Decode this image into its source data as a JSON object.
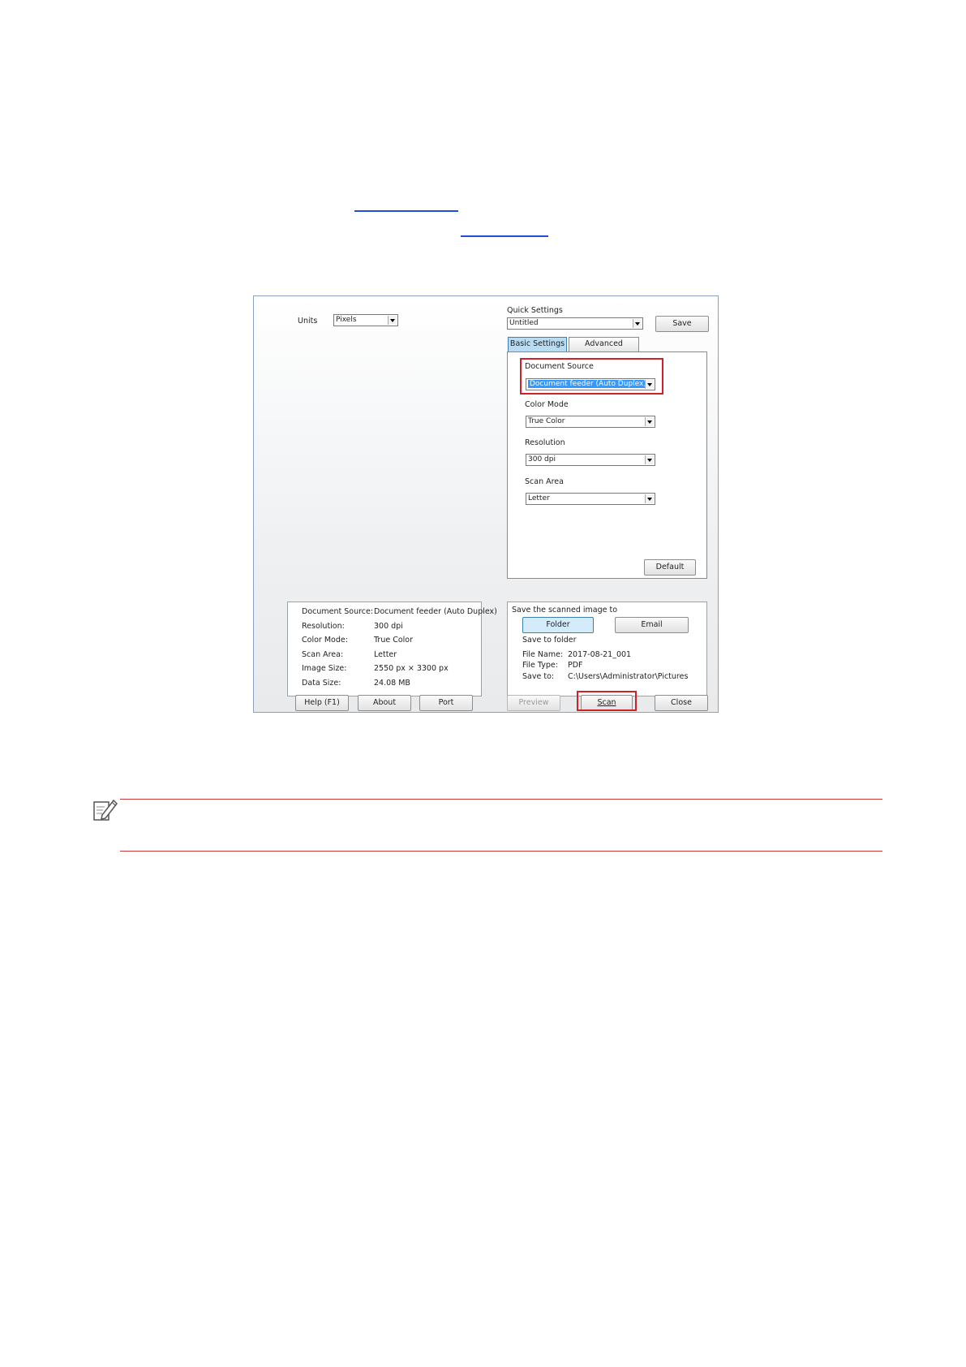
{
  "dialog": {
    "units_label": "Units",
    "units_value": "Pixels",
    "quick_settings_label": "Quick Settings",
    "quick_settings_value": "Untitled",
    "save_button": "Save",
    "tabs": [
      "Basic Settings",
      "Advanced Settings"
    ],
    "basic": {
      "document_source_label": "Document Source",
      "document_source_value": "Document feeder (Auto Duplex)",
      "color_mode_label": "Color Mode",
      "color_mode_value": "True Color",
      "resolution_label": "Resolution",
      "resolution_value": "300 dpi",
      "scan_area_label": "Scan Area",
      "scan_area_value": "Letter",
      "default_button": "Default"
    },
    "info": [
      {
        "k": "Document Source:",
        "v": "Document feeder (Auto Duplex)"
      },
      {
        "k": "Resolution:",
        "v": "300 dpi"
      },
      {
        "k": "Color Mode:",
        "v": "True Color"
      },
      {
        "k": "Scan Area:",
        "v": "Letter"
      },
      {
        "k": "Image Size:",
        "v": "2550 px × 3300 px"
      },
      {
        "k": "Data Size:",
        "v": "24.08 MB"
      }
    ],
    "save_panel": {
      "title": "Save the scanned image to",
      "folder_button": "Folder",
      "email_button": "Email",
      "save_to_folder": "Save to folder",
      "file_name_label": "File Name:",
      "file_name_value": "2017-08-21_001",
      "file_type_label": "File Type:",
      "file_type_value": "PDF",
      "save_to_label": "Save to:",
      "save_to_value": "C:\\Users\\Administrator\\Pictures"
    },
    "bottom_buttons": {
      "help": "Help (F1)",
      "about": "About",
      "port": "Port",
      "preview": "Preview",
      "scan": "Scan",
      "close": "Close"
    }
  },
  "colors": {
    "highlight_red": "#d0202a",
    "link_blue": "#1f4fd6",
    "note_line": "#c83a3a",
    "tab_active": "#b9dcf2",
    "folder_active": "#d4ecfa"
  },
  "icons": {
    "note": "note-pencil-icon"
  }
}
